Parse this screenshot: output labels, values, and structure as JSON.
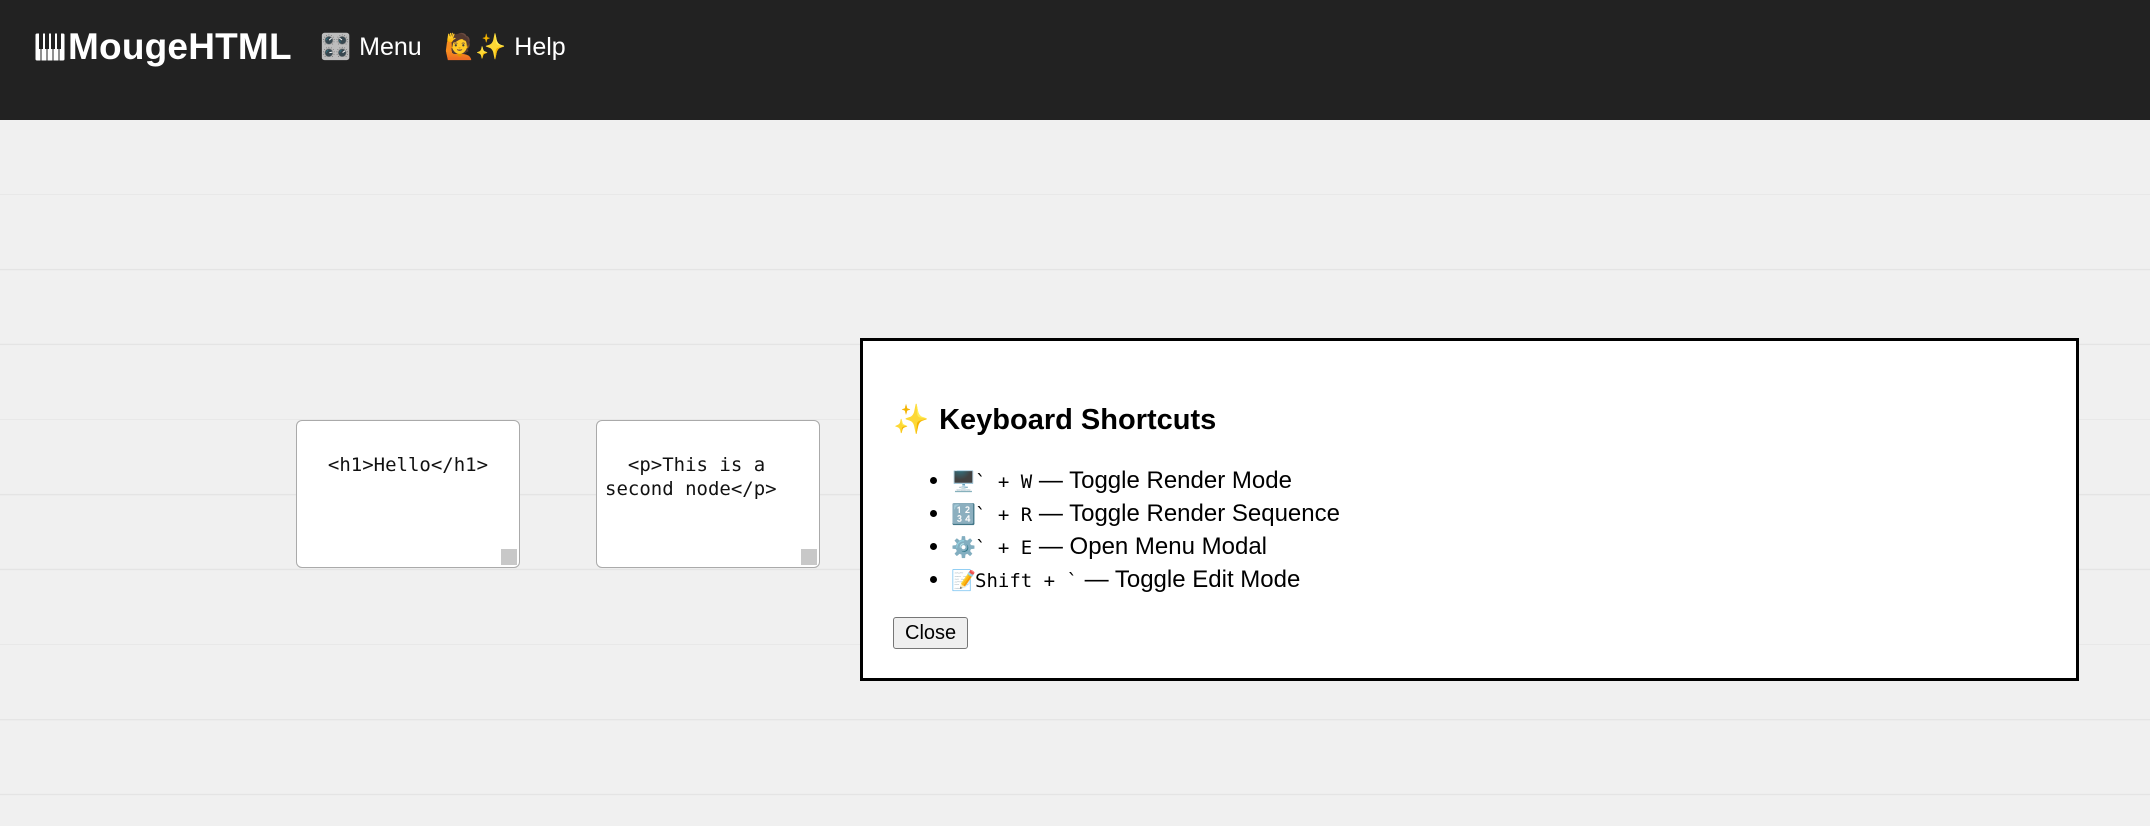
{
  "header": {
    "brand_name": "MougeHTML",
    "brand_icon": "piano-keys-icon",
    "menu_icon": "control-knobs-icon",
    "menu_icon_glyph": "🎛️",
    "menu_label": "Menu",
    "help_icon": "raising-hand-sparkles-icon",
    "help_icon_glyph": "🙋✨",
    "help_label": "Help"
  },
  "nodes": [
    {
      "content": "<h1>Hello</h1>"
    },
    {
      "content": "<p>This is a second node</p>"
    }
  ],
  "modal": {
    "title_icon": "sparkles-icon",
    "title_icon_glyph": "✨",
    "title": "Keyboard Shortcuts",
    "shortcuts": [
      {
        "icon": "desktop-icon",
        "glyph": "🖥️",
        "keys": "` + W",
        "separator": " — ",
        "action": "Toggle Render Mode"
      },
      {
        "icon": "numbers-icon",
        "glyph": "🔢",
        "keys": "` + R",
        "separator": " — ",
        "action": "Toggle Render Sequence"
      },
      {
        "icon": "gear-icon",
        "glyph": "⚙️",
        "keys": "` + E",
        "separator": " — ",
        "action": "Open Menu Modal"
      },
      {
        "icon": "memo-icon",
        "glyph": "📝",
        "keys": "Shift + `",
        "separator": " — ",
        "action": "Toggle Edit Mode"
      }
    ],
    "close_label": "Close"
  },
  "colors": {
    "header_bg": "#222222",
    "canvas_bg": "#f0f0f0",
    "modal_border": "#000000"
  }
}
